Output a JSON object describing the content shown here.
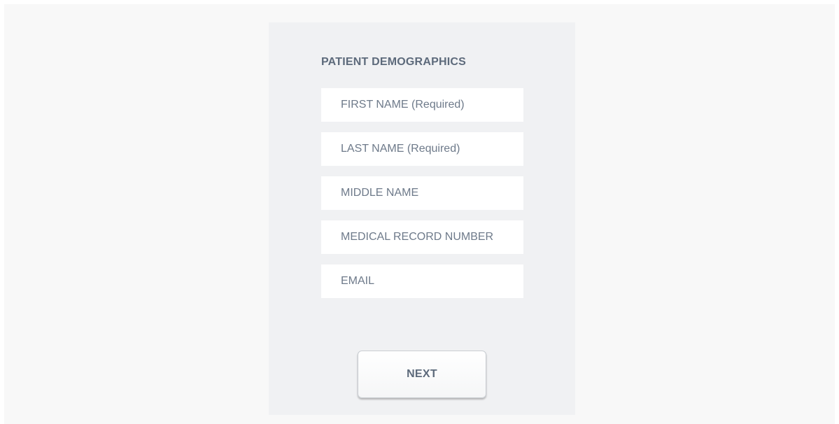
{
  "form": {
    "title": "PATIENT DEMOGRAPHICS",
    "fields": {
      "first_name": {
        "placeholder": "FIRST NAME (Required)",
        "value": ""
      },
      "last_name": {
        "placeholder": "LAST NAME (Required)",
        "value": ""
      },
      "middle_name": {
        "placeholder": "MIDDLE NAME",
        "value": ""
      },
      "medical_record_number": {
        "placeholder": "MEDICAL RECORD NUMBER",
        "value": ""
      },
      "email": {
        "placeholder": "EMAIL",
        "value": ""
      }
    },
    "next_label": "NEXT"
  },
  "colors": {
    "page_background": "#f8f8f8",
    "panel_background": "#f0f1f3",
    "field_background": "#ffffff",
    "label_text": "#5d6a7b",
    "placeholder_text": "#6e7a8a"
  }
}
